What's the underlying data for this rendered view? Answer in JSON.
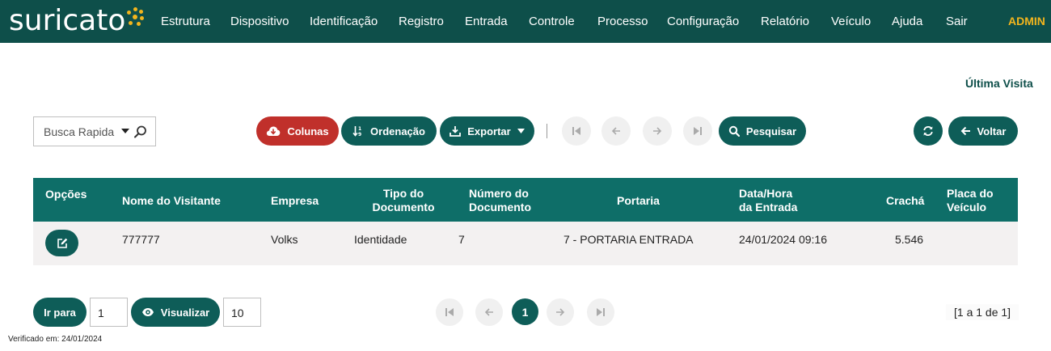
{
  "brand": {
    "logo_text": "suricato",
    "accent": "#f2b51d",
    "primary": "#0e4f4a"
  },
  "nav": {
    "items": [
      "Estrutura",
      "Dispositivo",
      "Identificação",
      "Registro",
      "Entrada",
      "Controle",
      "Processo",
      "Configuração",
      "Relatório",
      "Veículo",
      "Ajuda",
      "Sair"
    ],
    "user": "ADMIN"
  },
  "page": {
    "ultima_visita": "Última Visita"
  },
  "toolbar": {
    "busca_label": "Busca Rapida",
    "colunas": "Colunas",
    "ordenacao": "Ordenação",
    "exportar": "Exportar",
    "pesquisar": "Pesquisar",
    "voltar": "Voltar"
  },
  "table": {
    "headers": {
      "opcoes": "Opções",
      "nome": "Nome do Visitante",
      "empresa": "Empresa",
      "tipo_doc_1": "Tipo do",
      "tipo_doc_2": "Documento",
      "num_doc_1": "Número do",
      "num_doc_2": "Documento",
      "portaria": "Portaria",
      "data_1": "Data/Hora",
      "data_2": "da Entrada",
      "cracha": "Crachá",
      "placa_1": "Placa do",
      "placa_2": "Veículo"
    },
    "rows": [
      {
        "nome": "777777",
        "empresa": "Volks",
        "tipo": "Identidade",
        "numero": "7",
        "portaria": "7 - PORTARIA ENTRADA",
        "data": "24/01/2024 09:16",
        "cracha": "5.546",
        "placa": ""
      }
    ]
  },
  "pagination": {
    "ir_para": "Ir para",
    "page_value": "1",
    "visualizar": "Visualizar",
    "per_page": "10",
    "current_page": "1",
    "summary": "[1 a 1 de 1]"
  },
  "footer": {
    "verificado": "Verificado em: 24/01/2024"
  }
}
